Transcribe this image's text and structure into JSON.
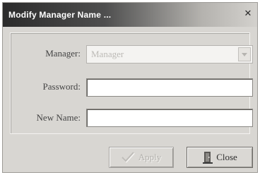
{
  "dialog": {
    "title": "Modify Manager Name ...",
    "close_glyph": "✕"
  },
  "form": {
    "manager_label": "Manager:",
    "manager_value": "Manager",
    "password_label": "Password:",
    "password_value": "",
    "new_name_label": "New Name:",
    "new_name_value": ""
  },
  "buttons": {
    "apply_label": "Apply",
    "apply_enabled": false,
    "apply_icon": "check-icon",
    "close_label": "Close",
    "close_icon": "door-icon"
  },
  "colors": {
    "titlebar_dark": "#2b2b2b",
    "window_bg": "#d8d6d2",
    "disabled_text": "#b3b1ad"
  }
}
